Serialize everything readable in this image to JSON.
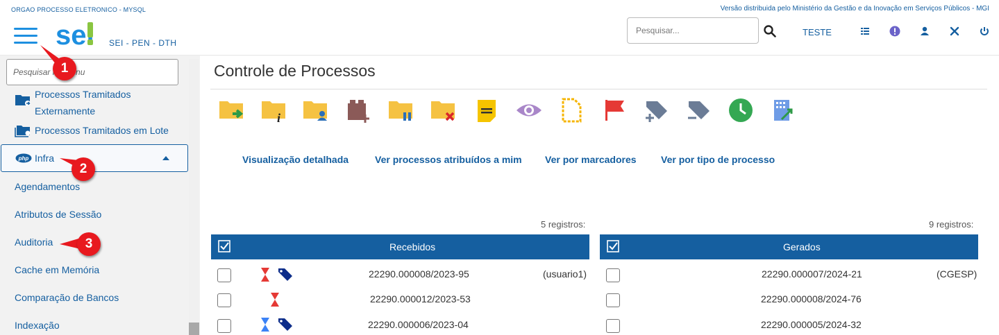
{
  "header": {
    "org_label": "ORGAO PROCESSO ELETRONICO - MYSQL",
    "versao_label": "Versão distribuida pelo Ministério da Gestão e da Inovação em Serviços Públicos - MGI",
    "logo_text": "sei!",
    "subtitle": "SEI - PEN - DTH",
    "search_placeholder": "Pesquisar...",
    "unidade": "TESTE"
  },
  "sidebar": {
    "search_placeholder": "Pesquisar no Menu",
    "items": [
      {
        "label_line1": "Processos Tramitados",
        "label_line2": "Externamente"
      },
      {
        "label": "Processos Tramitados em Lote"
      },
      {
        "label": "Infra"
      },
      {
        "label": "Agendamentos"
      },
      {
        "label": "Atributos de Sessão"
      },
      {
        "label": "Auditoria"
      },
      {
        "label": "Cache em Memória"
      },
      {
        "label": "Comparação de Bancos"
      },
      {
        "label": "Indexação"
      }
    ]
  },
  "callouts": [
    "1",
    "2",
    "3"
  ],
  "main": {
    "title": "Controle de Processos",
    "toolbar_icons": [
      "send-process-icon",
      "process-info-icon",
      "assign-user-icon",
      "add-block-icon",
      "pause-process-icon",
      "close-process-icon",
      "annotation-icon",
      "view-icon",
      "new-document-icon",
      "flag-icon",
      "add-tag-icon",
      "remove-tag-icon",
      "clock-icon",
      "stats-icon"
    ],
    "links": [
      "Visualização detalhada",
      "Ver processos atribuídos a mim",
      "Ver por marcadores",
      "Ver por tipo de processo"
    ]
  },
  "recebidos": {
    "count": "5 registros:",
    "title": "Recebidos",
    "rows": [
      {
        "number": "22290.000008/2023-95",
        "user": "(usuario1)",
        "icons": [
          "hourglass-red",
          "tag-navy"
        ]
      },
      {
        "number": "22290.000012/2023-53",
        "user": "",
        "icons": [
          "hourglass-red"
        ]
      },
      {
        "number": "22290.000006/2023-04",
        "user": "",
        "icons": [
          "hourglass-blue",
          "tag-navy"
        ]
      }
    ]
  },
  "gerados": {
    "count": "9 registros:",
    "title": "Gerados",
    "rows": [
      {
        "number": "22290.000007/2024-21",
        "unit": "(CGESP)"
      },
      {
        "number": "22290.000008/2024-76",
        "unit": ""
      },
      {
        "number": "22290.000005/2024-32",
        "unit": ""
      }
    ]
  },
  "colors": {
    "primary": "#155fa0",
    "header_bar": "#155fa0",
    "accent_blue": "#1d8fe0",
    "callout": "#e8191f",
    "logo_green": "#8ac541"
  }
}
